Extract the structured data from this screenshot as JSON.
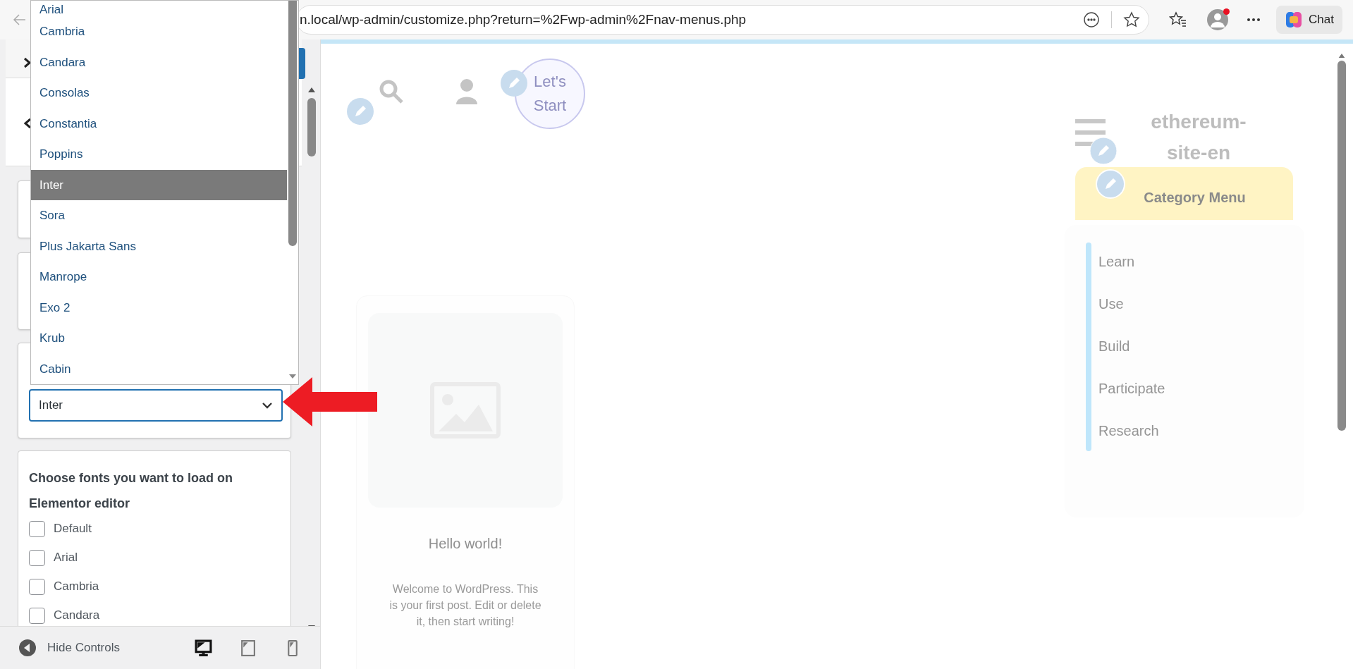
{
  "browser": {
    "address": "n.local/wp-admin/customize.php?return=%2Fwp-admin%2Fnav-menus.php",
    "chat_label": "Chat"
  },
  "font_dropdown": {
    "value": "Inter",
    "options": [
      {
        "label": "Arial",
        "selected": false
      },
      {
        "label": "Cambria",
        "selected": false
      },
      {
        "label": "Candara",
        "selected": false
      },
      {
        "label": "Consolas",
        "selected": false
      },
      {
        "label": "Constantia",
        "selected": false
      },
      {
        "label": "Poppins",
        "selected": false
      },
      {
        "label": "Inter",
        "selected": true
      },
      {
        "label": "Sora",
        "selected": false
      },
      {
        "label": "Plus Jakarta Sans",
        "selected": false
      },
      {
        "label": "Manrope",
        "selected": false
      },
      {
        "label": "Exo 2",
        "selected": false
      },
      {
        "label": "Krub",
        "selected": false
      },
      {
        "label": "Cabin",
        "selected": false
      }
    ]
  },
  "load_fonts_card": {
    "title": "Choose fonts you want to load on Elementor editor",
    "options": [
      {
        "label": "Default",
        "checked": false
      },
      {
        "label": "Arial",
        "checked": false
      },
      {
        "label": "Cambria",
        "checked": false
      },
      {
        "label": "Candara",
        "checked": false
      }
    ]
  },
  "footer": {
    "hide_controls": "Hide Controls",
    "devices": [
      {
        "kind": "desktop",
        "selected": true
      },
      {
        "kind": "tablet",
        "selected": false
      },
      {
        "kind": "mobile",
        "selected": false
      }
    ]
  },
  "preview": {
    "cta": "Let's Start",
    "site_title": "ethereum-site-en",
    "category_menu": {
      "title": "Category Menu",
      "items": [
        "Learn",
        "Use",
        "Build",
        "Participate",
        "Research"
      ]
    },
    "post": {
      "title": "Hello world!",
      "excerpt": "Welcome to WordPress. This is your first post. Edit or delete it, then start writing!"
    }
  }
}
